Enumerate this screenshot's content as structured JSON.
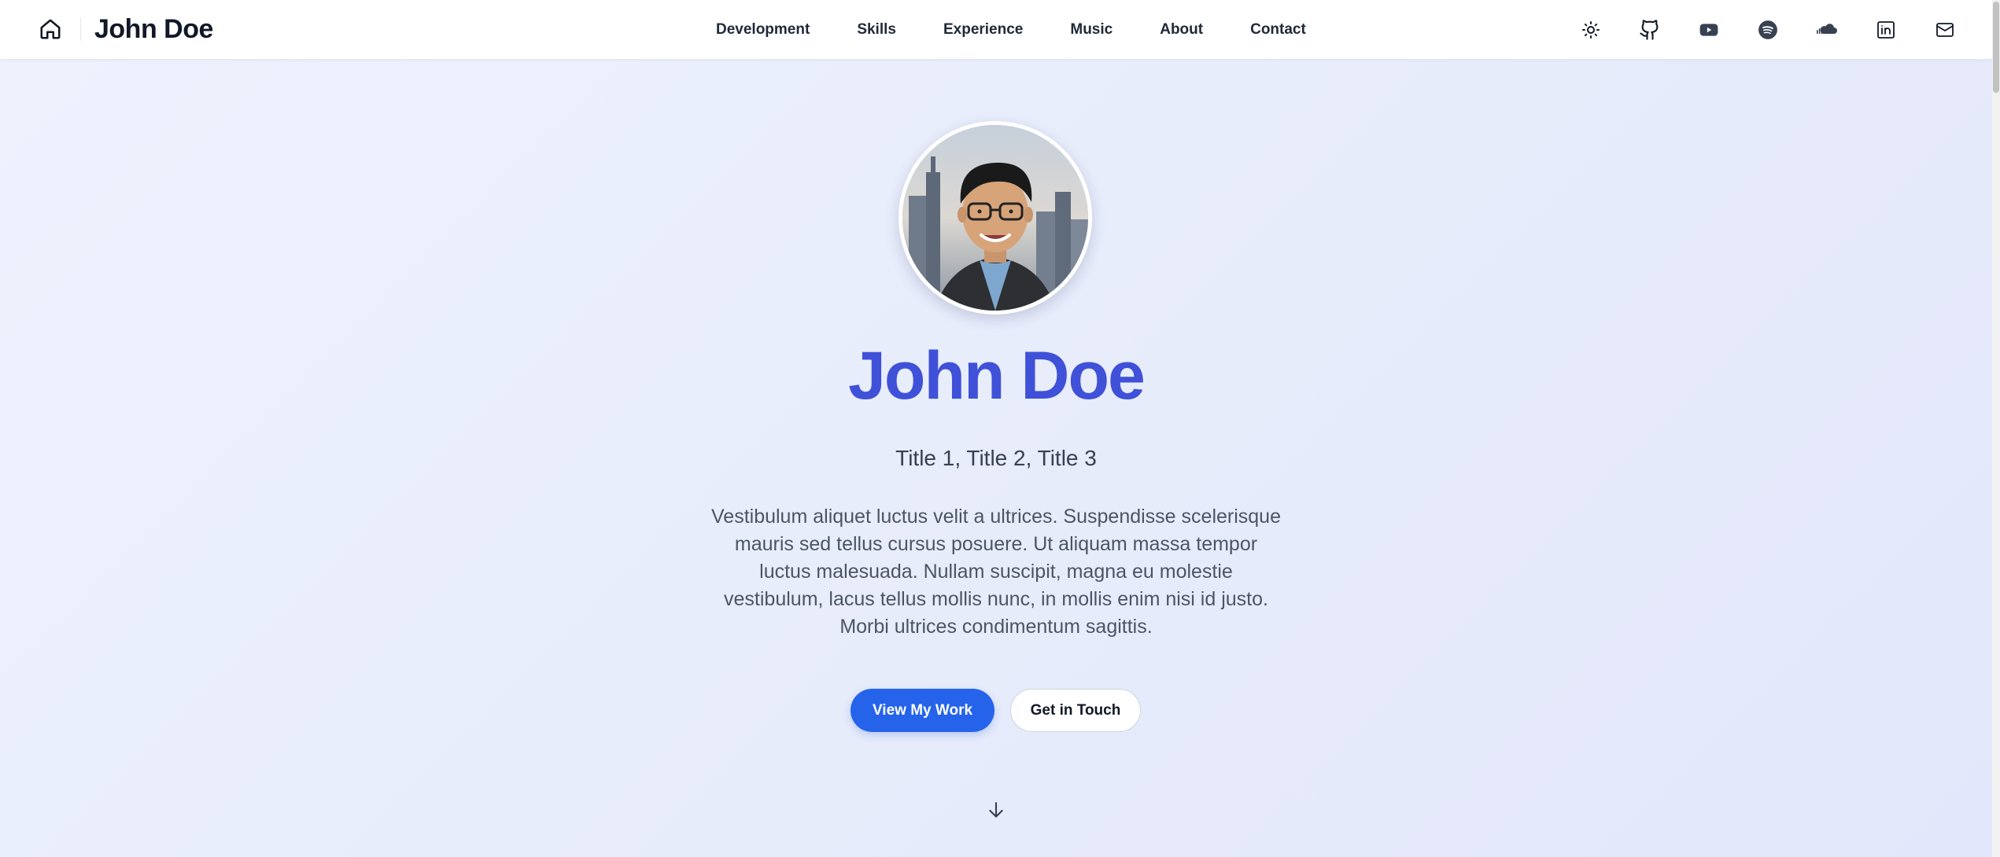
{
  "header": {
    "brand": "John Doe",
    "nav": [
      {
        "label": "Development"
      },
      {
        "label": "Skills"
      },
      {
        "label": "Experience"
      },
      {
        "label": "Music"
      },
      {
        "label": "About"
      },
      {
        "label": "Contact"
      }
    ],
    "icons": [
      "sun-icon",
      "github-icon",
      "youtube-icon",
      "spotify-icon",
      "soundcloud-icon",
      "linkedin-icon",
      "mail-icon"
    ]
  },
  "hero": {
    "name": "John Doe",
    "titles": "Title 1, Title 2, Title 3",
    "bio": "Vestibulum aliquet luctus velit a ultrices. Suspendisse scelerisque mauris sed tellus cursus posuere. Ut aliquam massa tempor luctus malesuada. Nullam suscipit, magna eu molestie vestibulum, lacus tellus mollis nunc, in mollis enim nisi id justo. Morbi ultrices condimentum sagittis.",
    "primary_button": "View My Work",
    "secondary_button": "Get in Touch"
  },
  "colors": {
    "accent": "#3f51d8",
    "primary_button": "#2563eb"
  }
}
